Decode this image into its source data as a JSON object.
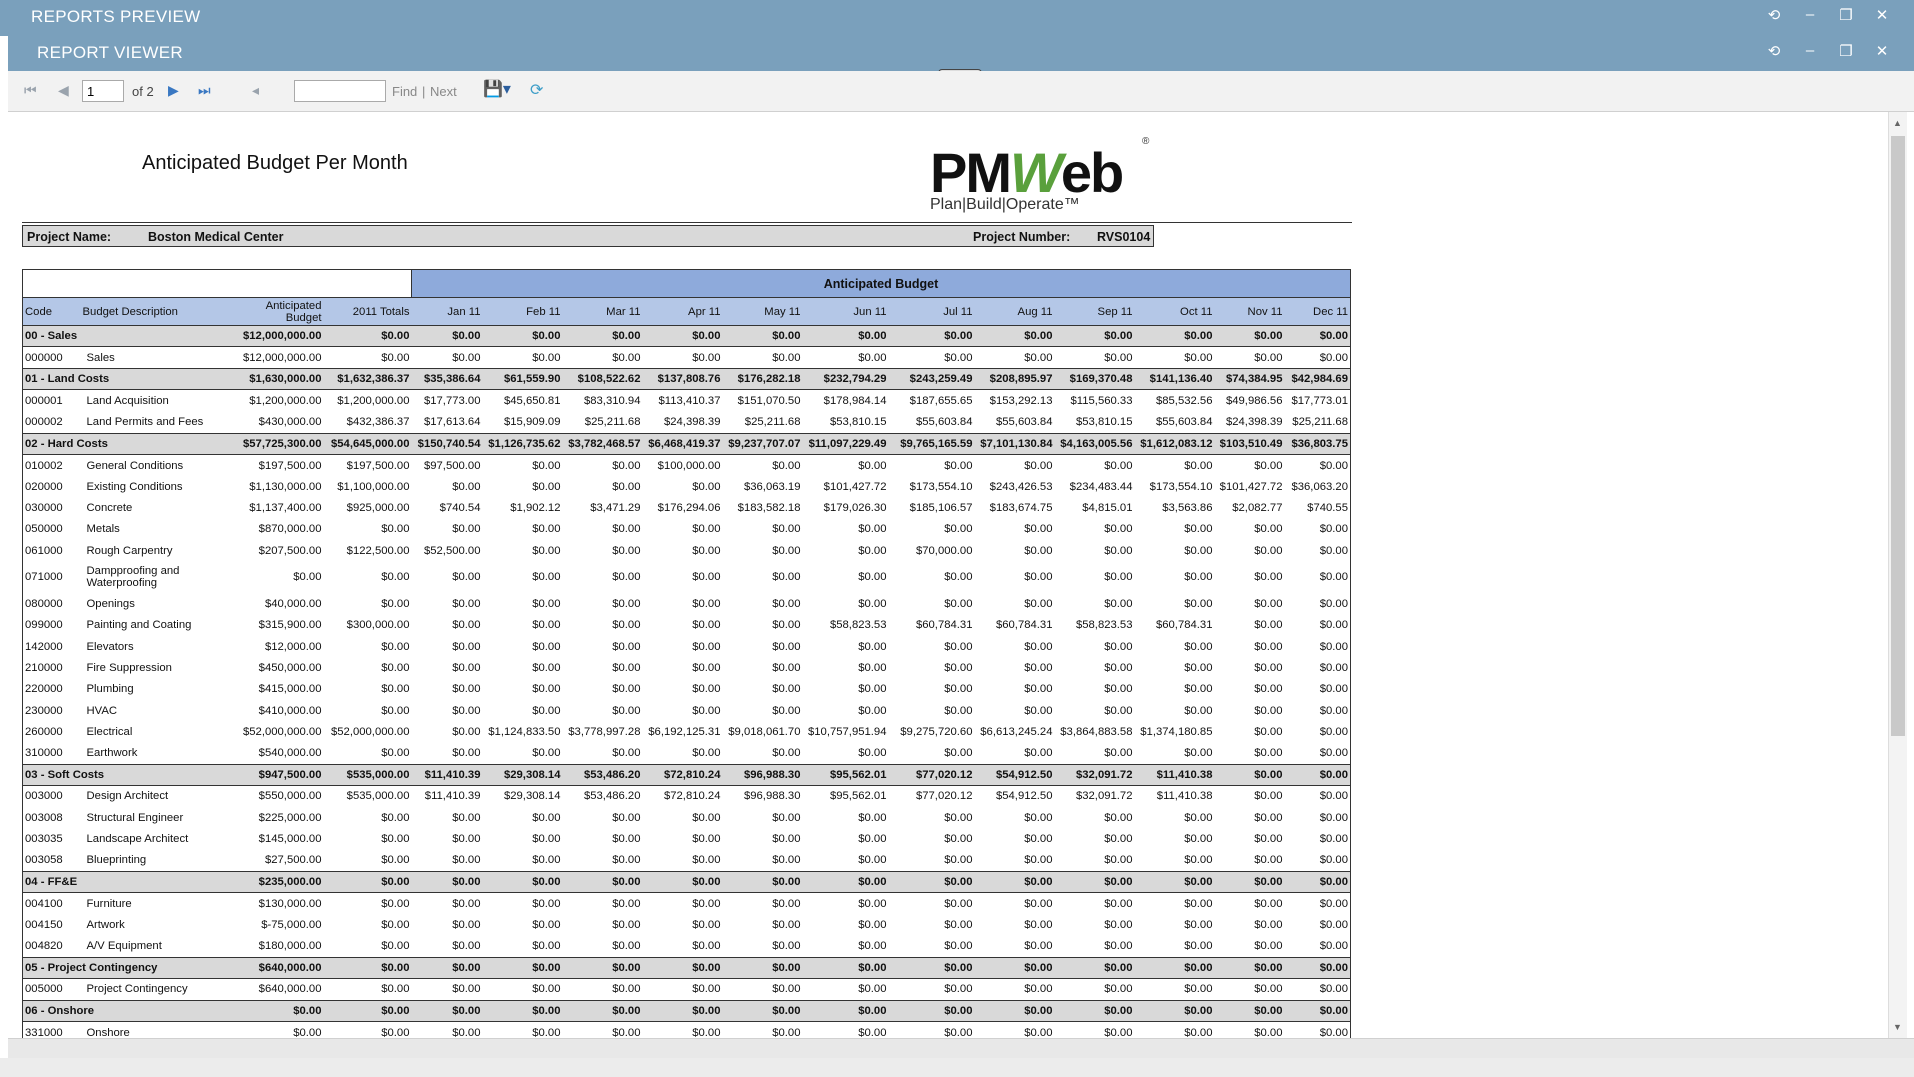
{
  "window": {
    "title": "REPORTS PREVIEW",
    "viewer_title": "REPORT VIEWER"
  },
  "toolbar": {
    "page_value": "1",
    "page_of": "of 2",
    "find_label": "Find",
    "separator": "|",
    "next_label": "Next"
  },
  "report": {
    "title": "Anticipated Budget Per Month",
    "logo_text_pm": "PM",
    "logo_text_w": "W",
    "logo_text_eb": "eb",
    "logo_tagline": "Plan|Build|Operate™",
    "logo_reg": "®",
    "project_name_label": "Project Name:",
    "project_name": "Boston Medical Center",
    "project_number_label": "Project Number:",
    "project_number": "RVS0104",
    "group_header": "Anticipated Budget",
    "columns": [
      "Code",
      "Budget Description",
      "Anticipated Budget",
      "2011 Totals",
      "Jan 11",
      "Feb 11",
      "Mar 11",
      "Apr 11",
      "May 11",
      "Jun 11",
      "Jul 11",
      "Aug 11",
      "Sep 11",
      "Oct 11",
      "Nov 11",
      "Dec 11"
    ],
    "rows": [
      {
        "type": "group",
        "cells": [
          "00 - Sales",
          "",
          "$12,000,000.00",
          "$0.00",
          "$0.00",
          "$0.00",
          "$0.00",
          "$0.00",
          "$0.00",
          "$0.00",
          "$0.00",
          "$0.00",
          "$0.00",
          "$0.00",
          "$0.00",
          "$0.00"
        ]
      },
      {
        "type": "item",
        "cells": [
          "000000",
          "Sales",
          "$12,000,000.00",
          "$0.00",
          "$0.00",
          "$0.00",
          "$0.00",
          "$0.00",
          "$0.00",
          "$0.00",
          "$0.00",
          "$0.00",
          "$0.00",
          "$0.00",
          "$0.00",
          "$0.00"
        ]
      },
      {
        "type": "group",
        "cells": [
          "01 - Land Costs",
          "",
          "$1,630,000.00",
          "$1,632,386.37",
          "$35,386.64",
          "$61,559.90",
          "$108,522.62",
          "$137,808.76",
          "$176,282.18",
          "$232,794.29",
          "$243,259.49",
          "$208,895.97",
          "$169,370.48",
          "$141,136.40",
          "$74,384.95",
          "$42,984.69"
        ]
      },
      {
        "type": "item",
        "cells": [
          "000001",
          "Land Acquisition",
          "$1,200,000.00",
          "$1,200,000.00",
          "$17,773.00",
          "$45,650.81",
          "$83,310.94",
          "$113,410.37",
          "$151,070.50",
          "$178,984.14",
          "$187,655.65",
          "$153,292.13",
          "$115,560.33",
          "$85,532.56",
          "$49,986.56",
          "$17,773.01"
        ]
      },
      {
        "type": "item",
        "cells": [
          "000002",
          "Land Permits and Fees",
          "$430,000.00",
          "$432,386.37",
          "$17,613.64",
          "$15,909.09",
          "$25,211.68",
          "$24,398.39",
          "$25,211.68",
          "$53,810.15",
          "$55,603.84",
          "$55,603.84",
          "$53,810.15",
          "$55,603.84",
          "$24,398.39",
          "$25,211.68"
        ]
      },
      {
        "type": "group",
        "cells": [
          "02 - Hard Costs",
          "",
          "$57,725,300.00",
          "$54,645,000.00",
          "$150,740.54",
          "$1,126,735.62",
          "$3,782,468.57",
          "$6,468,419.37",
          "$9,237,707.07",
          "$11,097,229.49",
          "$9,765,165.59",
          "$7,101,130.84",
          "$4,163,005.56",
          "$1,612,083.12",
          "$103,510.49",
          "$36,803.75"
        ]
      },
      {
        "type": "item",
        "cells": [
          "010002",
          "General Conditions",
          "$197,500.00",
          "$197,500.00",
          "$97,500.00",
          "$0.00",
          "$0.00",
          "$100,000.00",
          "$0.00",
          "$0.00",
          "$0.00",
          "$0.00",
          "$0.00",
          "$0.00",
          "$0.00",
          "$0.00"
        ]
      },
      {
        "type": "item",
        "cells": [
          "020000",
          "Existing Conditions",
          "$1,130,000.00",
          "$1,100,000.00",
          "$0.00",
          "$0.00",
          "$0.00",
          "$0.00",
          "$36,063.19",
          "$101,427.72",
          "$173,554.10",
          "$243,426.53",
          "$234,483.44",
          "$173,554.10",
          "$101,427.72",
          "$36,063.20"
        ]
      },
      {
        "type": "item",
        "cells": [
          "030000",
          "Concrete",
          "$1,137,400.00",
          "$925,000.00",
          "$740.54",
          "$1,902.12",
          "$3,471.29",
          "$176,294.06",
          "$183,582.18",
          "$179,026.30",
          "$185,106.57",
          "$183,674.75",
          "$4,815.01",
          "$3,563.86",
          "$2,082.77",
          "$740.55"
        ]
      },
      {
        "type": "item",
        "cells": [
          "050000",
          "Metals",
          "$870,000.00",
          "$0.00",
          "$0.00",
          "$0.00",
          "$0.00",
          "$0.00",
          "$0.00",
          "$0.00",
          "$0.00",
          "$0.00",
          "$0.00",
          "$0.00",
          "$0.00",
          "$0.00"
        ]
      },
      {
        "type": "item",
        "cells": [
          "061000",
          "Rough Carpentry",
          "$207,500.00",
          "$122,500.00",
          "$52,500.00",
          "$0.00",
          "$0.00",
          "$0.00",
          "$0.00",
          "$0.00",
          "$70,000.00",
          "$0.00",
          "$0.00",
          "$0.00",
          "$0.00",
          "$0.00"
        ]
      },
      {
        "type": "item",
        "tall": true,
        "cells": [
          "071000",
          "Dampproofing and Waterproofing",
          "$0.00",
          "$0.00",
          "$0.00",
          "$0.00",
          "$0.00",
          "$0.00",
          "$0.00",
          "$0.00",
          "$0.00",
          "$0.00",
          "$0.00",
          "$0.00",
          "$0.00",
          "$0.00"
        ]
      },
      {
        "type": "item",
        "cells": [
          "080000",
          "Openings",
          "$40,000.00",
          "$0.00",
          "$0.00",
          "$0.00",
          "$0.00",
          "$0.00",
          "$0.00",
          "$0.00",
          "$0.00",
          "$0.00",
          "$0.00",
          "$0.00",
          "$0.00",
          "$0.00"
        ]
      },
      {
        "type": "item",
        "cells": [
          "099000",
          "Painting and Coating",
          "$315,900.00",
          "$300,000.00",
          "$0.00",
          "$0.00",
          "$0.00",
          "$0.00",
          "$0.00",
          "$58,823.53",
          "$60,784.31",
          "$60,784.31",
          "$58,823.53",
          "$60,784.31",
          "$0.00",
          "$0.00"
        ]
      },
      {
        "type": "item",
        "cells": [
          "142000",
          "Elevators",
          "$12,000.00",
          "$0.00",
          "$0.00",
          "$0.00",
          "$0.00",
          "$0.00",
          "$0.00",
          "$0.00",
          "$0.00",
          "$0.00",
          "$0.00",
          "$0.00",
          "$0.00",
          "$0.00"
        ]
      },
      {
        "type": "item",
        "cells": [
          "210000",
          "Fire Suppression",
          "$450,000.00",
          "$0.00",
          "$0.00",
          "$0.00",
          "$0.00",
          "$0.00",
          "$0.00",
          "$0.00",
          "$0.00",
          "$0.00",
          "$0.00",
          "$0.00",
          "$0.00",
          "$0.00"
        ]
      },
      {
        "type": "item",
        "cells": [
          "220000",
          "Plumbing",
          "$415,000.00",
          "$0.00",
          "$0.00",
          "$0.00",
          "$0.00",
          "$0.00",
          "$0.00",
          "$0.00",
          "$0.00",
          "$0.00",
          "$0.00",
          "$0.00",
          "$0.00",
          "$0.00"
        ]
      },
      {
        "type": "item",
        "cells": [
          "230000",
          "HVAC",
          "$410,000.00",
          "$0.00",
          "$0.00",
          "$0.00",
          "$0.00",
          "$0.00",
          "$0.00",
          "$0.00",
          "$0.00",
          "$0.00",
          "$0.00",
          "$0.00",
          "$0.00",
          "$0.00"
        ]
      },
      {
        "type": "item",
        "cells": [
          "260000",
          "Electrical",
          "$52,000,000.00",
          "$52,000,000.00",
          "$0.00",
          "$1,124,833.50",
          "$3,778,997.28",
          "$6,192,125.31",
          "$9,018,061.70",
          "$10,757,951.94",
          "$9,275,720.60",
          "$6,613,245.24",
          "$3,864,883.58",
          "$1,374,180.85",
          "$0.00",
          "$0.00"
        ]
      },
      {
        "type": "item",
        "cells": [
          "310000",
          "Earthwork",
          "$540,000.00",
          "$0.00",
          "$0.00",
          "$0.00",
          "$0.00",
          "$0.00",
          "$0.00",
          "$0.00",
          "$0.00",
          "$0.00",
          "$0.00",
          "$0.00",
          "$0.00",
          "$0.00"
        ]
      },
      {
        "type": "group",
        "cells": [
          "03 - Soft Costs",
          "",
          "$947,500.00",
          "$535,000.00",
          "$11,410.39",
          "$29,308.14",
          "$53,486.20",
          "$72,810.24",
          "$96,988.30",
          "$95,562.01",
          "$77,020.12",
          "$54,912.50",
          "$32,091.72",
          "$11,410.38",
          "$0.00",
          "$0.00"
        ]
      },
      {
        "type": "item",
        "cells": [
          "003000",
          "Design Architect",
          "$550,000.00",
          "$535,000.00",
          "$11,410.39",
          "$29,308.14",
          "$53,486.20",
          "$72,810.24",
          "$96,988.30",
          "$95,562.01",
          "$77,020.12",
          "$54,912.50",
          "$32,091.72",
          "$11,410.38",
          "$0.00",
          "$0.00"
        ]
      },
      {
        "type": "item",
        "cells": [
          "003008",
          "Structural Engineer",
          "$225,000.00",
          "$0.00",
          "$0.00",
          "$0.00",
          "$0.00",
          "$0.00",
          "$0.00",
          "$0.00",
          "$0.00",
          "$0.00",
          "$0.00",
          "$0.00",
          "$0.00",
          "$0.00"
        ]
      },
      {
        "type": "item",
        "cells": [
          "003035",
          "Landscape Architect",
          "$145,000.00",
          "$0.00",
          "$0.00",
          "$0.00",
          "$0.00",
          "$0.00",
          "$0.00",
          "$0.00",
          "$0.00",
          "$0.00",
          "$0.00",
          "$0.00",
          "$0.00",
          "$0.00"
        ]
      },
      {
        "type": "item",
        "cells": [
          "003058",
          "Blueprinting",
          "$27,500.00",
          "$0.00",
          "$0.00",
          "$0.00",
          "$0.00",
          "$0.00",
          "$0.00",
          "$0.00",
          "$0.00",
          "$0.00",
          "$0.00",
          "$0.00",
          "$0.00",
          "$0.00"
        ]
      },
      {
        "type": "group",
        "cells": [
          "04 - FF&E",
          "",
          "$235,000.00",
          "$0.00",
          "$0.00",
          "$0.00",
          "$0.00",
          "$0.00",
          "$0.00",
          "$0.00",
          "$0.00",
          "$0.00",
          "$0.00",
          "$0.00",
          "$0.00",
          "$0.00"
        ]
      },
      {
        "type": "item",
        "cells": [
          "004100",
          "Furniture",
          "$130,000.00",
          "$0.00",
          "$0.00",
          "$0.00",
          "$0.00",
          "$0.00",
          "$0.00",
          "$0.00",
          "$0.00",
          "$0.00",
          "$0.00",
          "$0.00",
          "$0.00",
          "$0.00"
        ]
      },
      {
        "type": "item",
        "cells": [
          "004150",
          "Artwork",
          "$-75,000.00",
          "$0.00",
          "$0.00",
          "$0.00",
          "$0.00",
          "$0.00",
          "$0.00",
          "$0.00",
          "$0.00",
          "$0.00",
          "$0.00",
          "$0.00",
          "$0.00",
          "$0.00"
        ]
      },
      {
        "type": "item",
        "cells": [
          "004820",
          "A/V Equipment",
          "$180,000.00",
          "$0.00",
          "$0.00",
          "$0.00",
          "$0.00",
          "$0.00",
          "$0.00",
          "$0.00",
          "$0.00",
          "$0.00",
          "$0.00",
          "$0.00",
          "$0.00",
          "$0.00"
        ]
      },
      {
        "type": "group",
        "cells": [
          "05 - Project Contingency",
          "",
          "$640,000.00",
          "$0.00",
          "$0.00",
          "$0.00",
          "$0.00",
          "$0.00",
          "$0.00",
          "$0.00",
          "$0.00",
          "$0.00",
          "$0.00",
          "$0.00",
          "$0.00",
          "$0.00"
        ]
      },
      {
        "type": "item",
        "cells": [
          "005000",
          "Project Contingency",
          "$640,000.00",
          "$0.00",
          "$0.00",
          "$0.00",
          "$0.00",
          "$0.00",
          "$0.00",
          "$0.00",
          "$0.00",
          "$0.00",
          "$0.00",
          "$0.00",
          "$0.00",
          "$0.00"
        ]
      },
      {
        "type": "group",
        "cells": [
          "06 - Onshore",
          "",
          "$0.00",
          "$0.00",
          "$0.00",
          "$0.00",
          "$0.00",
          "$0.00",
          "$0.00",
          "$0.00",
          "$0.00",
          "$0.00",
          "$0.00",
          "$0.00",
          "$0.00",
          "$0.00"
        ]
      },
      {
        "type": "item",
        "cells": [
          "331000",
          "Onshore",
          "$0.00",
          "$0.00",
          "$0.00",
          "$0.00",
          "$0.00",
          "$0.00",
          "$0.00",
          "$0.00",
          "$0.00",
          "$0.00",
          "$0.00",
          "$0.00",
          "$0.00",
          "$0.00"
        ]
      }
    ]
  },
  "colors": {
    "titlebar": "#7aa0bc",
    "group_row": "#d9d9d9",
    "header_blue": "#8eaadb",
    "header_light": "#b4c7e7"
  },
  "icons": {
    "refresh": "refresh-icon",
    "minimize": "minimize-icon",
    "maximize": "maximize-icon",
    "close": "close-icon",
    "first_page": "first-page-icon",
    "prev_page": "prev-page-icon",
    "next_page": "next-page-icon",
    "last_page": "last-page-icon",
    "back": "back-icon",
    "save": "save-icon",
    "refresh_report": "refresh-report-icon"
  }
}
